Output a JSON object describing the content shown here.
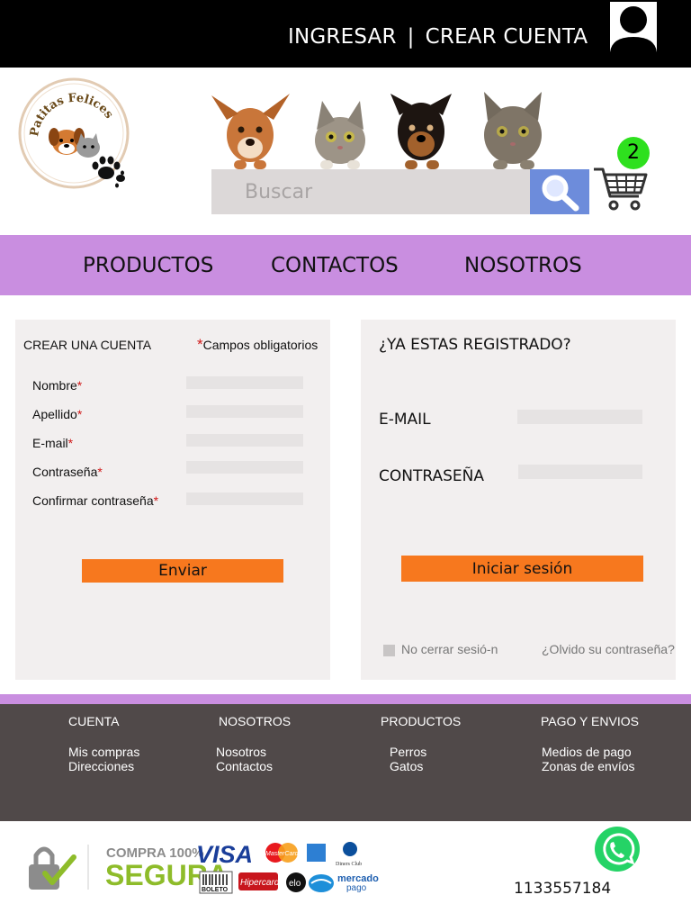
{
  "topbar": {
    "login_label": "INGRESAR",
    "separator": "|",
    "register_label": "CREAR CUENTA"
  },
  "header": {
    "logo_text": "Patitas Felices",
    "search_placeholder": "Buscar",
    "cart_count": "2"
  },
  "nav": {
    "items": [
      {
        "label": "PRODUCTOS"
      },
      {
        "label": "CONTACTOS"
      },
      {
        "label": "NOSOTROS"
      }
    ]
  },
  "register": {
    "title": "CREAR UNA CUENTA",
    "required_mark": "*",
    "required_note": "Campos obligatorios",
    "fields": [
      {
        "label": "Nombre"
      },
      {
        "label": "Apellido"
      },
      {
        "label": "E-mail"
      },
      {
        "label": "Contraseña"
      },
      {
        "label": "Confirmar contraseña"
      }
    ],
    "submit_label": "Enviar"
  },
  "login": {
    "title": "¿YA ESTAS REGISTRADO?",
    "email_label": "E-MAIL",
    "password_label": "CONTRASEÑA",
    "submit_label": "Iniciar sesión",
    "remember_label": "No cerrar sesió-n",
    "forgot_label": "¿Olvido su contraseña?"
  },
  "footer": {
    "columns": [
      {
        "title": "CUENTA",
        "links": [
          "Mis compras",
          "Direcciones"
        ]
      },
      {
        "title": "NOSOTROS",
        "links": [
          "Nosotros",
          "Contactos"
        ]
      },
      {
        "title": "PRODUCTOS",
        "links": [
          "Perros",
          "Gatos"
        ]
      },
      {
        "title": "PAGO Y ENVIOS",
        "links": [
          "Medios de pago",
          "Zonas de envíos"
        ]
      }
    ]
  },
  "bottom": {
    "secure_line1": "COMPRA 100%",
    "secure_line2": "SEGURA",
    "visa": "VISA",
    "mastercard": "MasterCard",
    "diners": "Diners Club",
    "boleto": "BOLETO",
    "hipercard": "Hipercard",
    "elo": "elo",
    "mercado_pago_1": "mercado",
    "mercado_pago_2": "pago",
    "phone": "1133557184"
  },
  "colors": {
    "nav_bg": "#c98ee0",
    "accent_orange": "#f7781e",
    "search_button": "#6d8cdb",
    "badge_green": "#2ee01e",
    "footer_bg": "#504949",
    "whatsapp_green": "#25d366"
  },
  "icons": {
    "avatar": "user-avatar-icon",
    "search": "magnifier-icon",
    "cart": "shopping-cart-icon",
    "lock": "lock-check-icon",
    "whatsapp": "whatsapp-icon"
  }
}
